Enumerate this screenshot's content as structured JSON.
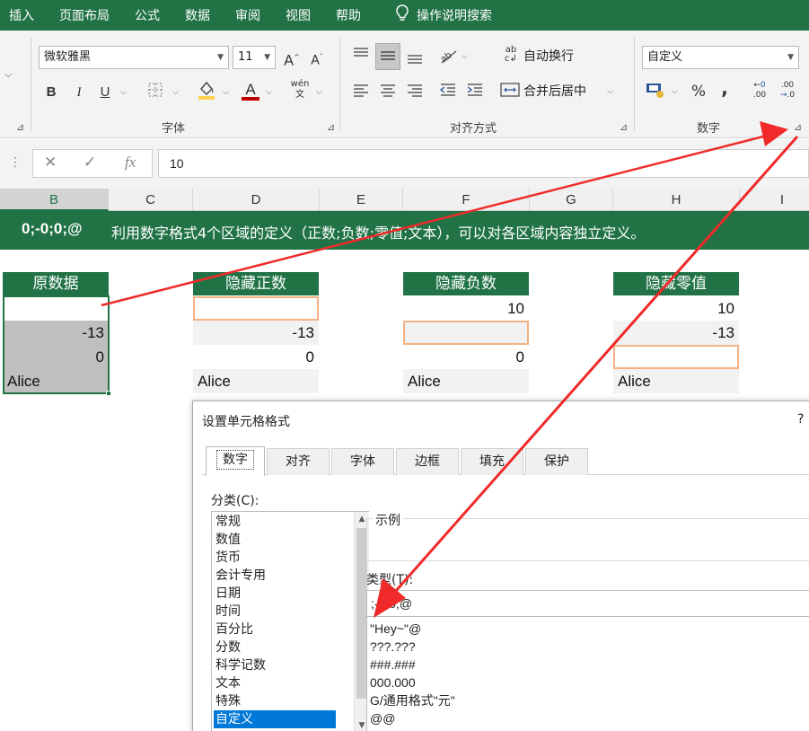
{
  "menu": {
    "items": [
      "插入",
      "页面布局",
      "公式",
      "数据",
      "审阅",
      "视图",
      "帮助"
    ],
    "search": "操作说明搜索"
  },
  "ribbon": {
    "font_name": "微软雅黑",
    "font_size": "11",
    "bold": "B",
    "italic": "I",
    "underline": "U",
    "grow_font": "A",
    "shrink_font": "A",
    "font_color_glyph": "A",
    "phonetic_glyph": "wén",
    "wrap_text": "自动换行",
    "merge_center": "合并后居中",
    "number_format": "自定义",
    "percent": "%",
    "comma": ",",
    "inc_decimal": ".00",
    "dec_decimal": ".0",
    "group_font": "字体",
    "group_alignment": "对齐方式",
    "group_number": "数字",
    "colors": {
      "accent": "#217346",
      "fill_bar": "#ffd24d",
      "font_bar": "#c00000"
    }
  },
  "formula_bar": {
    "cancel": "✕",
    "enter": "✓",
    "fx": "fx",
    "value": "10"
  },
  "columns": [
    "B",
    "C",
    "D",
    "E",
    "F",
    "G",
    "H",
    "I"
  ],
  "banner": {
    "code": "0;-0;0;@",
    "text": "利用数字格式4个区域的定义（正数;负数;零值;文本），可以对各区域内容独立定义。"
  },
  "blocks": [
    {
      "header": "原数据",
      "cells": [
        "",
        "-13",
        "0",
        "Alice"
      ]
    },
    {
      "header": "隐藏正数",
      "cells": [
        "",
        "-13",
        "0",
        "Alice"
      ]
    },
    {
      "header": "隐藏负数",
      "cells": [
        "10",
        "",
        "0",
        "Alice"
      ]
    },
    {
      "header": "隐藏零值",
      "cells": [
        "10",
        "-13",
        "",
        "Alice"
      ]
    }
  ],
  "dialog": {
    "title": "设置单元格格式",
    "help": "?",
    "tabs": [
      "数字",
      "对齐",
      "字体",
      "边框",
      "填充",
      "保护"
    ],
    "category_label": "分类(C):",
    "categories": [
      "常规",
      "数值",
      "货币",
      "会计专用",
      "日期",
      "时间",
      "百分比",
      "分数",
      "科学记数",
      "文本",
      "特殊",
      "自定义"
    ],
    "selected_category": "自定义",
    "sample_label": "示例",
    "type_label": "类型(T):",
    "type_value": ";-0;0;@",
    "formats": [
      "\"Hey~\"@",
      "???.???",
      "###.###",
      "000.000",
      "G/通用格式\"元\"",
      "@@"
    ]
  }
}
